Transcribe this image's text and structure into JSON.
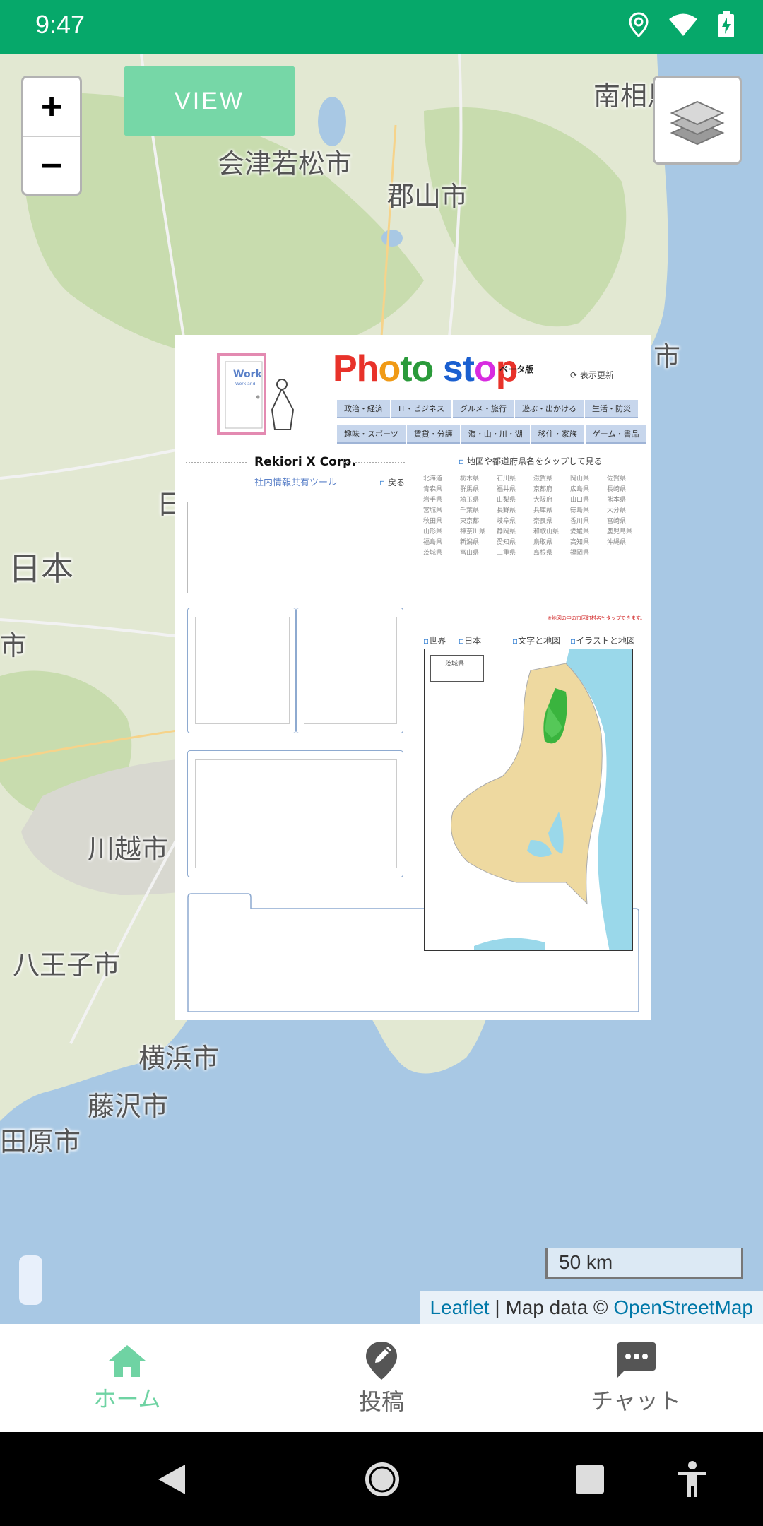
{
  "status_bar": {
    "time": "9:47"
  },
  "map": {
    "cities": [
      "南相馬",
      "会津若松市",
      "郡山市",
      "市",
      "日",
      "日本",
      "市",
      "川越市",
      "八王子市",
      "横浜市",
      "藤沢市",
      "田原市"
    ],
    "zoom_in_label": "+",
    "zoom_out_label": "−",
    "view_button_label": "VIEW",
    "scale_label": "50 km",
    "attribution": {
      "leaflet": "Leaflet",
      "separator": " | Map data © ",
      "osm": "OpenStreetMap"
    }
  },
  "overlay": {
    "brand": "Photo stop",
    "beta": "ベータ版",
    "refresh": "表示更新",
    "door_label": "Work",
    "door_sub": "Work and!",
    "tabs_row1": [
      "政治・経済",
      "IT・ビジネス",
      "グルメ・旅行",
      "遊ぶ・出かける",
      "生活・防災"
    ],
    "tabs_row2": [
      "趣味・スポーツ",
      "賃貸・分譲",
      "海・山・川・湖",
      "移住・家族",
      "ゲーム・書品"
    ],
    "company": "Rekiori X Corp.",
    "tool_link": "社内情報共有ツール",
    "back": "戻る",
    "map_prompt": "地図や都道府県名をタップして見る",
    "prefectures": [
      "北海道",
      "栃木県",
      "石川県",
      "滋賀県",
      "岡山県",
      "佐賀県",
      "青森県",
      "群馬県",
      "福井県",
      "京都府",
      "広島県",
      "長崎県",
      "岩手県",
      "埼玉県",
      "山梨県",
      "大阪府",
      "山口県",
      "熊本県",
      "宮城県",
      "千葉県",
      "長野県",
      "兵庫県",
      "徳島県",
      "大分県",
      "秋田県",
      "東京都",
      "岐阜県",
      "奈良県",
      "香川県",
      "宮崎県",
      "山形県",
      "神奈川県",
      "静岡県",
      "和歌山県",
      "愛媛県",
      "鹿児島県",
      "福島県",
      "新潟県",
      "愛知県",
      "鳥取県",
      "高知県",
      "沖縄県",
      "茨城県",
      "富山県",
      "三重県",
      "島根県",
      "福岡県",
      ""
    ],
    "note": "※地図の中の市区町村名もタップできます。",
    "map_links": [
      "世界",
      "日本",
      "文字と地図",
      "イラストと地図"
    ],
    "inset_label": "茨城県"
  },
  "bottom_nav": [
    {
      "label": "ホーム",
      "icon": "home-icon",
      "active": true
    },
    {
      "label": "投稿",
      "icon": "edit-pin-icon",
      "active": false
    },
    {
      "label": "チャット",
      "icon": "chat-icon",
      "active": false
    }
  ],
  "colors": {
    "status_bar": "#06a86a",
    "accent": "#6fd3a3",
    "view_button": "#76d7a7"
  }
}
